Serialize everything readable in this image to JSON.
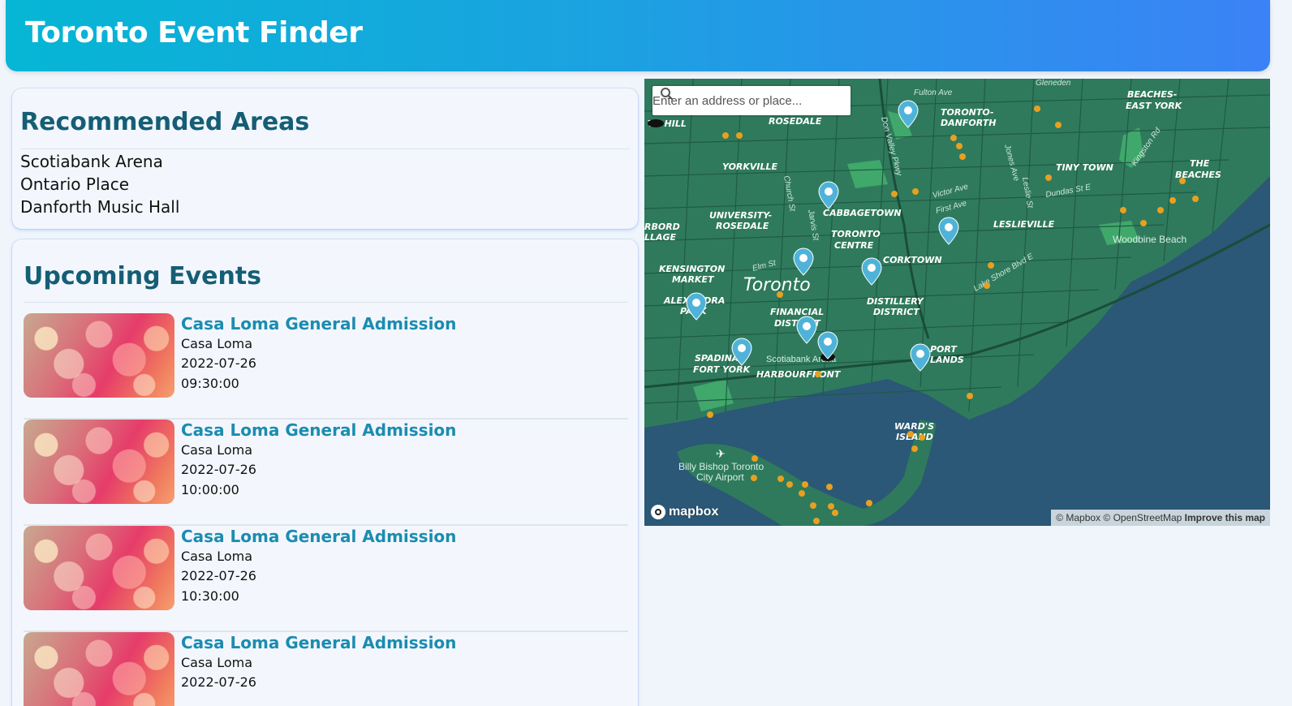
{
  "header": {
    "title": "Toronto Event Finder"
  },
  "areas": {
    "heading": "Recommended Areas",
    "items": [
      "Scotiabank Arena",
      "Ontario Place",
      "Danforth Music Hall"
    ]
  },
  "events": {
    "heading": "Upcoming Events",
    "items": [
      {
        "title": "Casa Loma General Admission",
        "venue": "Casa Loma",
        "date": "2022-07-26",
        "time": "09:30:00"
      },
      {
        "title": "Casa Loma General Admission",
        "venue": "Casa Loma",
        "date": "2022-07-26",
        "time": "10:00:00"
      },
      {
        "title": "Casa Loma General Admission",
        "venue": "Casa Loma",
        "date": "2022-07-26",
        "time": "10:30:00"
      },
      {
        "title": "Casa Loma General Admission",
        "venue": "Casa Loma",
        "date": "2022-07-26",
        "time": ""
      }
    ]
  },
  "map": {
    "search_placeholder": "Enter an address or place...",
    "logo": "mapbox",
    "attribution": "© Mapbox © OpenStreetMap",
    "improve": "Improve this map",
    "city_label": "Toronto",
    "neighbourhoods": [
      "ROSEDALE",
      "TORONTO-",
      "DANFORTH",
      "BEACHES-",
      "EAST YORK",
      "YORKVILLE",
      "TINY TOWN",
      "THE",
      "BEACHES",
      "UNIVERSITY-",
      "ROSEDALE",
      "CABBAGETOWN",
      "TORONTO",
      "CENTRE",
      "LESLIEVILLE",
      "KENSINGTON",
      "MARKET",
      "CORKTOWN",
      "ALEXANDRA",
      "PARK",
      "FINANCIAL",
      "DISTRICT",
      "DISTILLERY",
      "DISTRICT",
      "PORT",
      "LANDS",
      "SPADINA",
      "FORT YORK",
      "HARBOURFRONT",
      "WARD'S",
      "ISLAND",
      "TH HILL",
      "RBORD",
      "LLAGE"
    ],
    "streets": [
      "Fulton Ave",
      "Don Valley Pkwy",
      "Church St",
      "Jarvis St",
      "Jones Ave",
      "Leslie St",
      "Victor Ave",
      "First Ave",
      "Dundas St E",
      "Kingston Rd",
      "Lake Shore Blvd E",
      "Elm St",
      "Gleneden"
    ],
    "places": [
      "Woodbine Beach",
      "Scotiabank Arena",
      "Billy Bishop Toronto",
      "City Airport"
    ],
    "colors": {
      "land": "#2f7a5d",
      "water": "#2b5876",
      "park": "#3fa86a",
      "marker": "#4fb3d9",
      "dot": "#e8a020"
    }
  }
}
